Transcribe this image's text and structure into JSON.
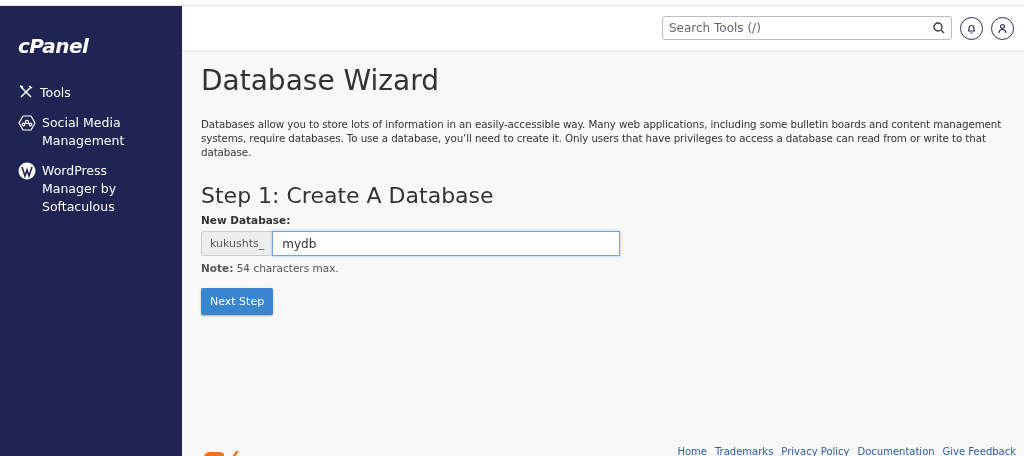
{
  "sidebar": {
    "logo": "cPanel",
    "items": [
      {
        "kind": "tools",
        "label": "Tools"
      },
      {
        "kind": "social",
        "label": "Social Media Management"
      },
      {
        "kind": "wordpress",
        "label": "WordPress Manager by Softaculous"
      }
    ]
  },
  "header": {
    "search": {
      "placeholder": "Search Tools (/)"
    }
  },
  "page": {
    "title": "Database Wizard",
    "intro": "Databases allow you to store lots of information in an easily-accessible way. Many web applications, including some bulletin boards and content management systems, require databases. To use a database, you’ll need to create it. Only users that have privileges to access a database can read from or write to that database.",
    "step_title": "Step 1: Create A Database",
    "field_label": "New Database:",
    "prefix": "kukushts_",
    "value": "mydb",
    "note": "**Note:** 54 characters max.",
    "button": "Next Step"
  },
  "footer": {
    "links": [
      "Home",
      "Trademarks",
      "Privacy Policy",
      "Documentation",
      "Give Feedback"
    ]
  }
}
